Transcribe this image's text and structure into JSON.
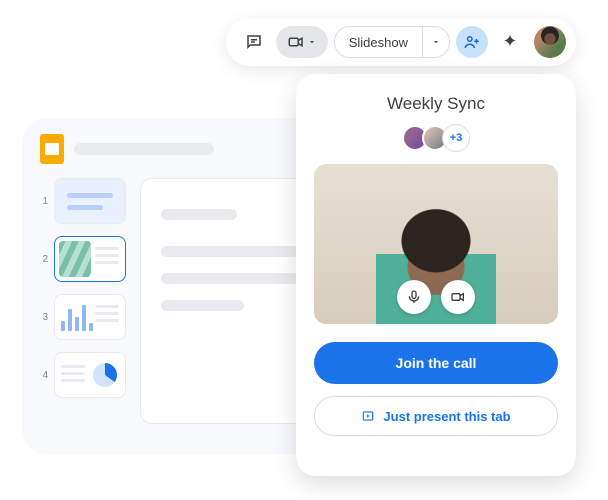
{
  "toolbar": {
    "slideshow_label": "Slideshow"
  },
  "editor": {
    "thumbs": [
      {
        "num": "1"
      },
      {
        "num": "2"
      },
      {
        "num": "3"
      },
      {
        "num": "4"
      }
    ]
  },
  "meet": {
    "title": "Weekly Sync",
    "more_participants": "+3",
    "join_label": "Join the call",
    "present_label": "Just present this tab"
  }
}
